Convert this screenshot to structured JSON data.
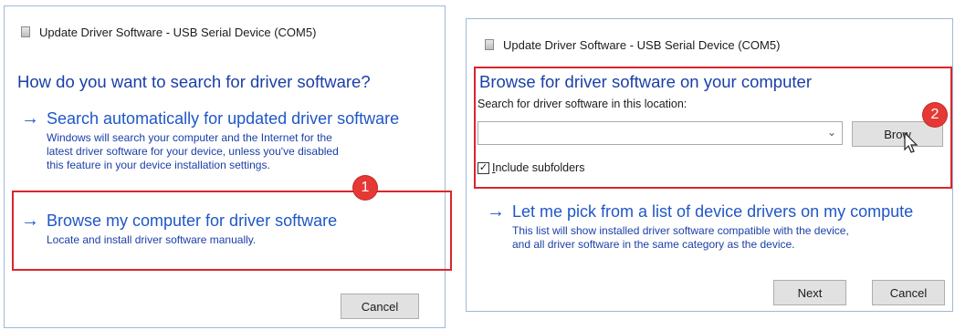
{
  "dialog1": {
    "title": "Update Driver Software - USB Serial Device (COM5)",
    "heading": "How do you want to search for driver software?",
    "option_search": {
      "title": "Search automatically for updated driver software",
      "desc_1": "Windows will search your computer and the Internet for the",
      "desc_2": "latest driver software for your device, unless you've disabled",
      "desc_3": "this feature in your device installation settings."
    },
    "option_browse": {
      "title": "Browse my computer for driver software",
      "desc": "Locate and install driver software manually."
    },
    "badge": "1",
    "cancel_label": "Cancel"
  },
  "dialog2": {
    "title": "Update Driver Software - USB Serial Device (COM5)",
    "heading": "Browse for driver software on your computer",
    "search_label": "Search for driver software in this location:",
    "path_value": "",
    "browse_label": "Brow",
    "include_subfolders_label": "Include subfolders",
    "include_subfolders_checked": true,
    "badge": "2",
    "option_pick": {
      "title": "Let me pick from a list of device drivers on my compute",
      "desc_1": "This list will show installed driver software compatible with the device,",
      "desc_2": "and all driver software in the same category as the device."
    },
    "next_label": "Next",
    "cancel_label": "Cancel"
  },
  "colors": {
    "link_blue": "#1f57c7",
    "heading_blue": "#1a3fa8",
    "highlight_red": "#d9262c",
    "badge_red": "#e53935"
  },
  "icons": {
    "option_arrow": "→",
    "combo_arrow": "⌄",
    "check": "✓"
  }
}
